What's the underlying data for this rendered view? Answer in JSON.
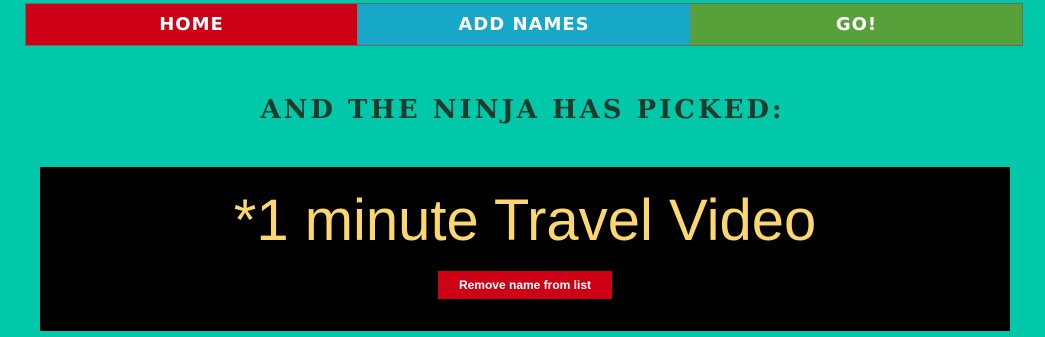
{
  "nav": {
    "home_label": "HOME",
    "add_names_label": "ADD NAMES",
    "go_label": "GO!"
  },
  "main": {
    "heading": "AND THE NINJA HAS PICKED:",
    "picked_name": "*1 minute Travel Video",
    "remove_button_label": "Remove name from list"
  },
  "colors": {
    "background": "#00c8a9",
    "home": "#ce0015",
    "add_names": "#16a8c6",
    "go": "#58a03a",
    "picked_text": "#fbd76d"
  }
}
